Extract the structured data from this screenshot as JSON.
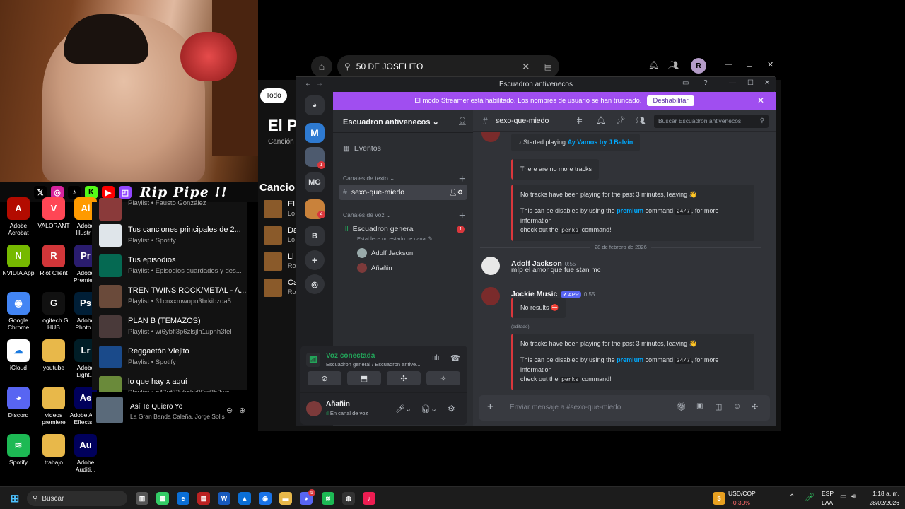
{
  "stream": {
    "overlay_name": "Rip Pipe !!",
    "social_icons": [
      "x-icon",
      "instagram-icon",
      "tiktok-icon",
      "kick-icon",
      "youtube-icon",
      "twitch-icon"
    ]
  },
  "desktop": {
    "icons": [
      {
        "label": "Adobe Acrobat",
        "glyph": "A",
        "color": "#b30b00"
      },
      {
        "label": "VALORANT",
        "glyph": "V",
        "color": "#ff4655"
      },
      {
        "label": "Adobe Illustr...",
        "glyph": "Ai",
        "color": "#ff9a00"
      },
      {
        "label": "NVIDIA App",
        "glyph": "N",
        "color": "#76b900"
      },
      {
        "label": "Riot Client",
        "glyph": "R",
        "color": "#d13639"
      },
      {
        "label": "Adobe Premie...",
        "glyph": "Pr",
        "color": "#2a1c6e"
      },
      {
        "label": "Google Chrome",
        "glyph": "◉",
        "color": "#4285f4"
      },
      {
        "label": "Logitech G HUB",
        "glyph": "G",
        "color": "#111111"
      },
      {
        "label": "Adobe Photo...",
        "glyph": "Ps",
        "color": "#001e36"
      },
      {
        "label": "iCloud",
        "glyph": "☁",
        "color": "#ffffff"
      },
      {
        "label": "youtube",
        "glyph": "",
        "color": "#e8b84a"
      },
      {
        "label": "Adobe Light...",
        "glyph": "Lr",
        "color": "#001d26"
      },
      {
        "label": "Discord",
        "glyph": "◕",
        "color": "#5865f2"
      },
      {
        "label": "videos premiere",
        "glyph": "",
        "color": "#e8b84a"
      },
      {
        "label": "Adobe After Effects...",
        "glyph": "Ae",
        "color": "#00005b"
      },
      {
        "label": "Spotify",
        "glyph": "≋",
        "color": "#1db954"
      },
      {
        "label": "trabajo",
        "glyph": "",
        "color": "#e8b84a"
      },
      {
        "label": "Adobe Auditi...",
        "glyph": "Au",
        "color": "#00005b"
      }
    ]
  },
  "spotify": {
    "search_value": "50 DE JOSELITO",
    "filter_chip": "Todo",
    "header_title": "El Pa",
    "header_sub": "Canción",
    "section_title": "Cancion",
    "playlists": [
      {
        "title": "Playlist • Fausto González",
        "sub": "",
        "color": "#8a3a3a"
      },
      {
        "title": "Tus canciones principales de 2...",
        "sub": "Playlist • Spotify",
        "color": "#dfe5ea"
      },
      {
        "title": "Tus episodios",
        "sub": "Playlist • Episodios guardados y des...",
        "color": "#056952"
      },
      {
        "title": "TREN TWINS ROCK/METAL - A...",
        "sub": "Playlist • 31cnxxmwopo3brkibzoa5...",
        "color": "#6a4a3a"
      },
      {
        "title": "PLAN B (TEMAZOS)",
        "sub": "Playlist • wi6ybfl3p6zlsjlh1upnh3fel",
        "color": "#4a3a3a"
      },
      {
        "title": "Reggaetón Viejito",
        "sub": "Playlist • Spotify",
        "color": "#1a4a8a"
      },
      {
        "title": "lo que hay x aquí",
        "sub": "Playlist • q47uf72ykgkk05uf8b3wa...",
        "color": "#6a8a3a"
      }
    ],
    "songs": [
      {
        "t": "El",
        "a": "Lo"
      },
      {
        "t": "Da",
        "a": "Lo"
      },
      {
        "t": "Li",
        "a": "Ro"
      },
      {
        "t": "Ca",
        "a": "Ro"
      }
    ],
    "now_playing": {
      "title": "Así Te Quiero Yo",
      "artist": "La Gran Banda Caleña, Jorge Solis"
    }
  },
  "discord": {
    "window_title": "Escuadron antivenecos",
    "banner_text": "El modo Streamer está habilitado. Los nombres de usuario se han truncado.",
    "banner_button": "Deshabilitar",
    "servers": [
      "M",
      "",
      "MG",
      "",
      "B"
    ],
    "server_badges": [
      "1",
      "4"
    ],
    "server_name": "Escuadron antivenecos",
    "events_label": "Eventos",
    "text_category": "Canales de texto",
    "text_channel": "sexo-que-miedo",
    "voice_category": "Canales de voz",
    "voice_channel": "Escuadron general",
    "voice_channel_badge": "1",
    "voice_status_prompt": "Establece un estado de canal",
    "voice_members": [
      "Adolf Jackson",
      "Añañin"
    ],
    "voice_connected": "Voz conectada",
    "voice_path": "Escuadron general / Escuadron antive...",
    "user_name": "Añañin",
    "user_status": "En canal de voz",
    "channel_header": "sexo-que-miedo",
    "search_placeholder": "Buscar Escuadron antivenecos",
    "messages": {
      "started_playing_prefix": "Started playing",
      "started_playing_track": "Ay Vamos by J Balvin",
      "no_more_tracks": "There are no more tracks",
      "idle_line": "No tracks have been playing for the past 3 minutes, leaving 👋",
      "disable_prefix": "This can be disabled by using the",
      "premium": "premium",
      "command_word": "command",
      "cmd_247": "24/7",
      "more_info": ", for more information",
      "check_out": "check out the",
      "perks": "perks",
      "command_end": "command!",
      "date_divider": "28 de febrero de 2026",
      "user1": "Adolf Jackson",
      "user1_time": "0:55",
      "user1_text": "m!p el amor que fue stan mc",
      "bot": "Jockie Music",
      "bot_tag": "✔ APP",
      "bot_time": "0:55",
      "no_results": "No results ⛔",
      "edited": "(editado)"
    },
    "input_placeholder": "Enviar mensaje a #sexo-que-miedo"
  },
  "taskbar": {
    "search_label": "Buscar",
    "ticker_name": "USD/COP",
    "ticker_change": "-0,30%",
    "lang": "ESP",
    "lang2": "LAA",
    "time": "1:18 a. m.",
    "date": "28/02/2026",
    "discord_badge": "5"
  }
}
